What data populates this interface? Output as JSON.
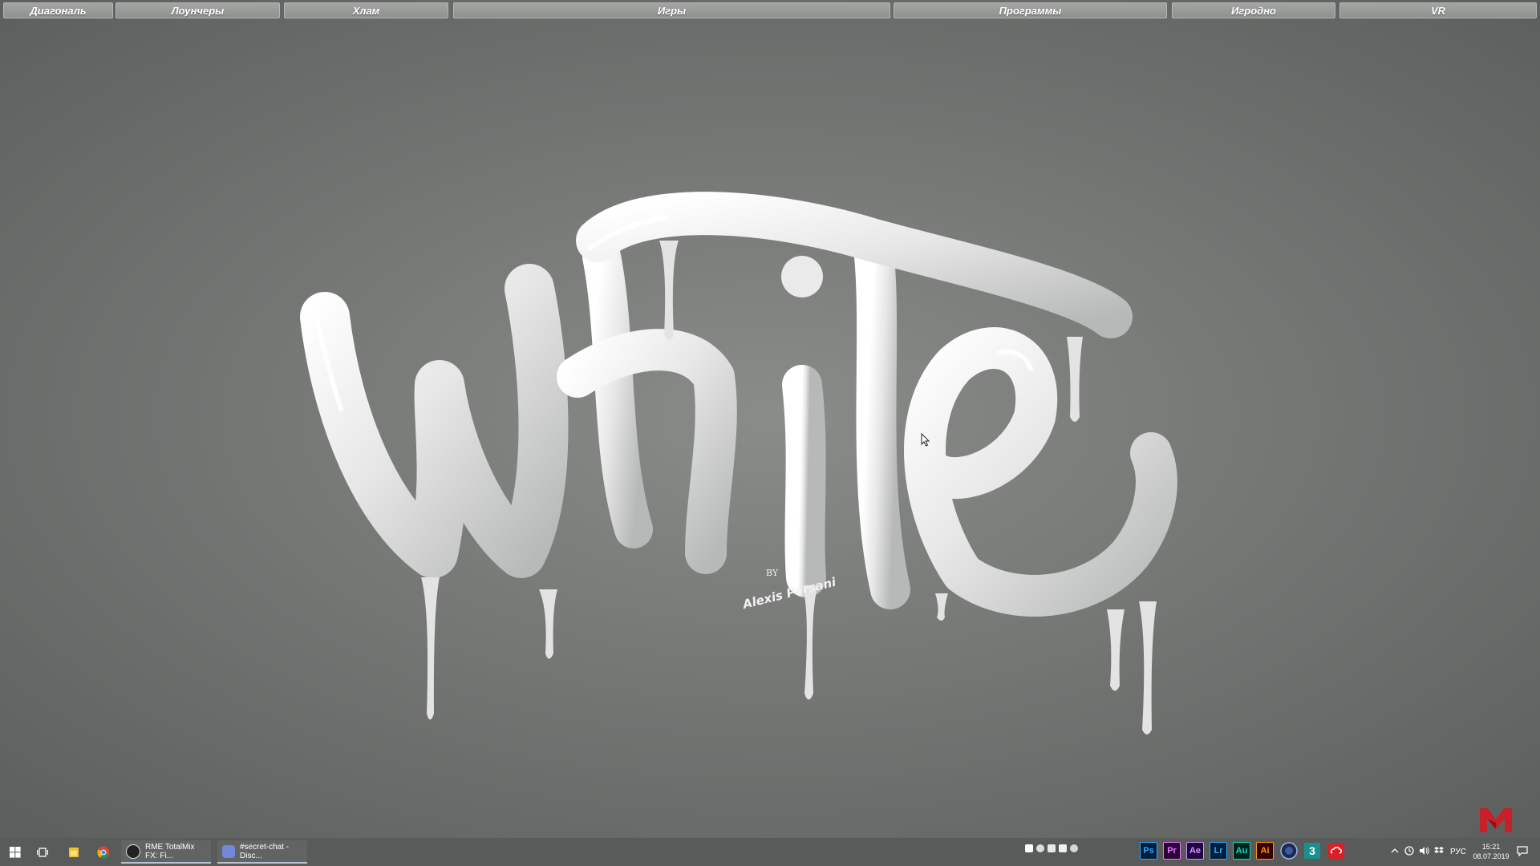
{
  "fences": [
    {
      "label": "Диагональ"
    },
    {
      "label": "Лоунчеры"
    },
    {
      "label": "Хлам"
    },
    {
      "label": "Игры"
    },
    {
      "label": "Программы"
    },
    {
      "label": "Игродно"
    },
    {
      "label": "VR"
    }
  ],
  "wallpaper": {
    "title": "White",
    "by_label": "BY",
    "author": "Alexis Persani"
  },
  "taskbar": {
    "tasks": [
      {
        "label": "RME TotalMix FX: Fi...",
        "icon": "totalmix-icon"
      },
      {
        "label": "#secret-chat - Disc...",
        "icon": "discord-icon"
      }
    ],
    "apps": [
      {
        "label": "Ps",
        "icon": "photoshop-icon",
        "color": "#31a8ff",
        "bg": "#001e36"
      },
      {
        "label": "Pr",
        "icon": "premiere-icon",
        "color": "#ea77ff",
        "bg": "#2a0634"
      },
      {
        "label": "Ae",
        "icon": "after-effects-icon",
        "color": "#d291ff",
        "bg": "#1f0740"
      },
      {
        "label": "Lr",
        "icon": "lightroom-icon",
        "color": "#31a8ff",
        "bg": "#001e36"
      },
      {
        "label": "Au",
        "icon": "audition-icon",
        "color": "#00e4bb",
        "bg": "#00201c"
      },
      {
        "label": "Ai",
        "icon": "illustrator-icon",
        "color": "#ff9a00",
        "bg": "#330000"
      }
    ],
    "tray": {
      "language": "РУС",
      "time": "15:21",
      "date": "08.07.2019"
    }
  },
  "colors": {
    "accent": "#b9c4cf",
    "fence_bg": "#9a9c9a",
    "taskbar_bg": "#585a59",
    "brand_logo": "#c8202a"
  }
}
